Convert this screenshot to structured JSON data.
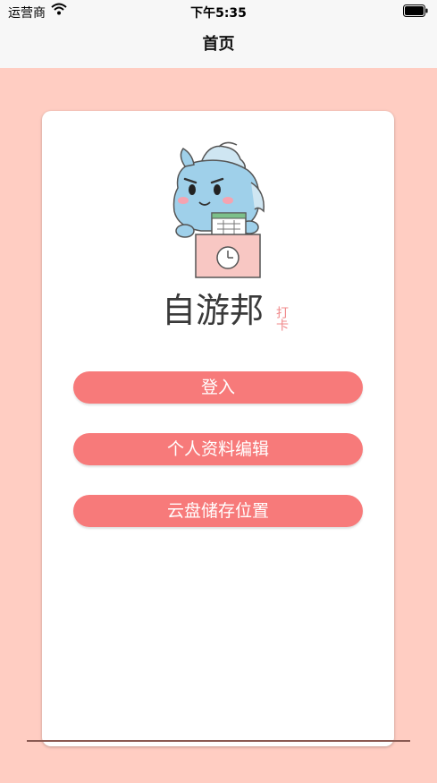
{
  "status_bar": {
    "carrier": "运营商",
    "time": "下午5:35"
  },
  "nav": {
    "title": "首页"
  },
  "brand": {
    "logo_text": "自游邦",
    "logo_sub": "打卡",
    "mascot_icon": "mascot-clock-card-icon"
  },
  "buttons": {
    "login": "登入",
    "profile_edit": "个人资料编辑",
    "cloud_storage": "云盘储存位置"
  },
  "colors": {
    "background": "#ffcdc2",
    "button": "#f77a7a",
    "logo_text": "#3a3a3a",
    "logo_sub": "#f0888a"
  }
}
